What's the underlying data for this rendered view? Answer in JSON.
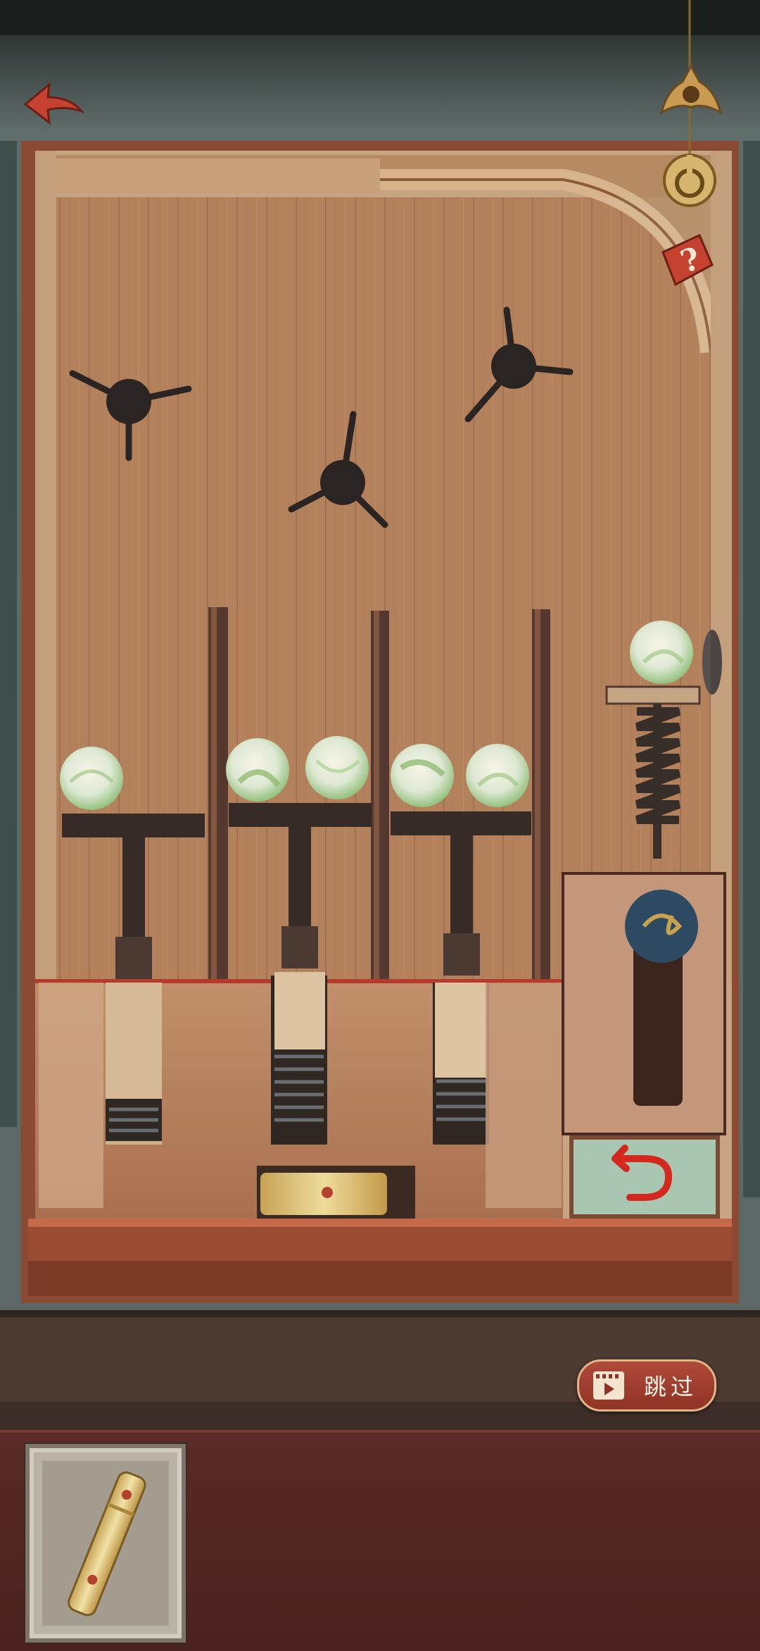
{
  "top_bar": {
    "back_icon": "back-arrow-icon",
    "settings_icon": "gear-icon",
    "hint_icon": "hint-lens-icon",
    "help_icon": "question-mark-icon"
  },
  "skip_button": {
    "label": "跳过",
    "icon": "video-ad-icon"
  },
  "inventory": {
    "items": [
      {
        "name": "bamboo-tube",
        "icon": "bamboo-tube-icon"
      }
    ]
  },
  "colors": {
    "accent_red": "#b4412f",
    "gold": "#c99a52",
    "wood": "#b07a4e",
    "inventory_bg": "#4f2523"
  }
}
